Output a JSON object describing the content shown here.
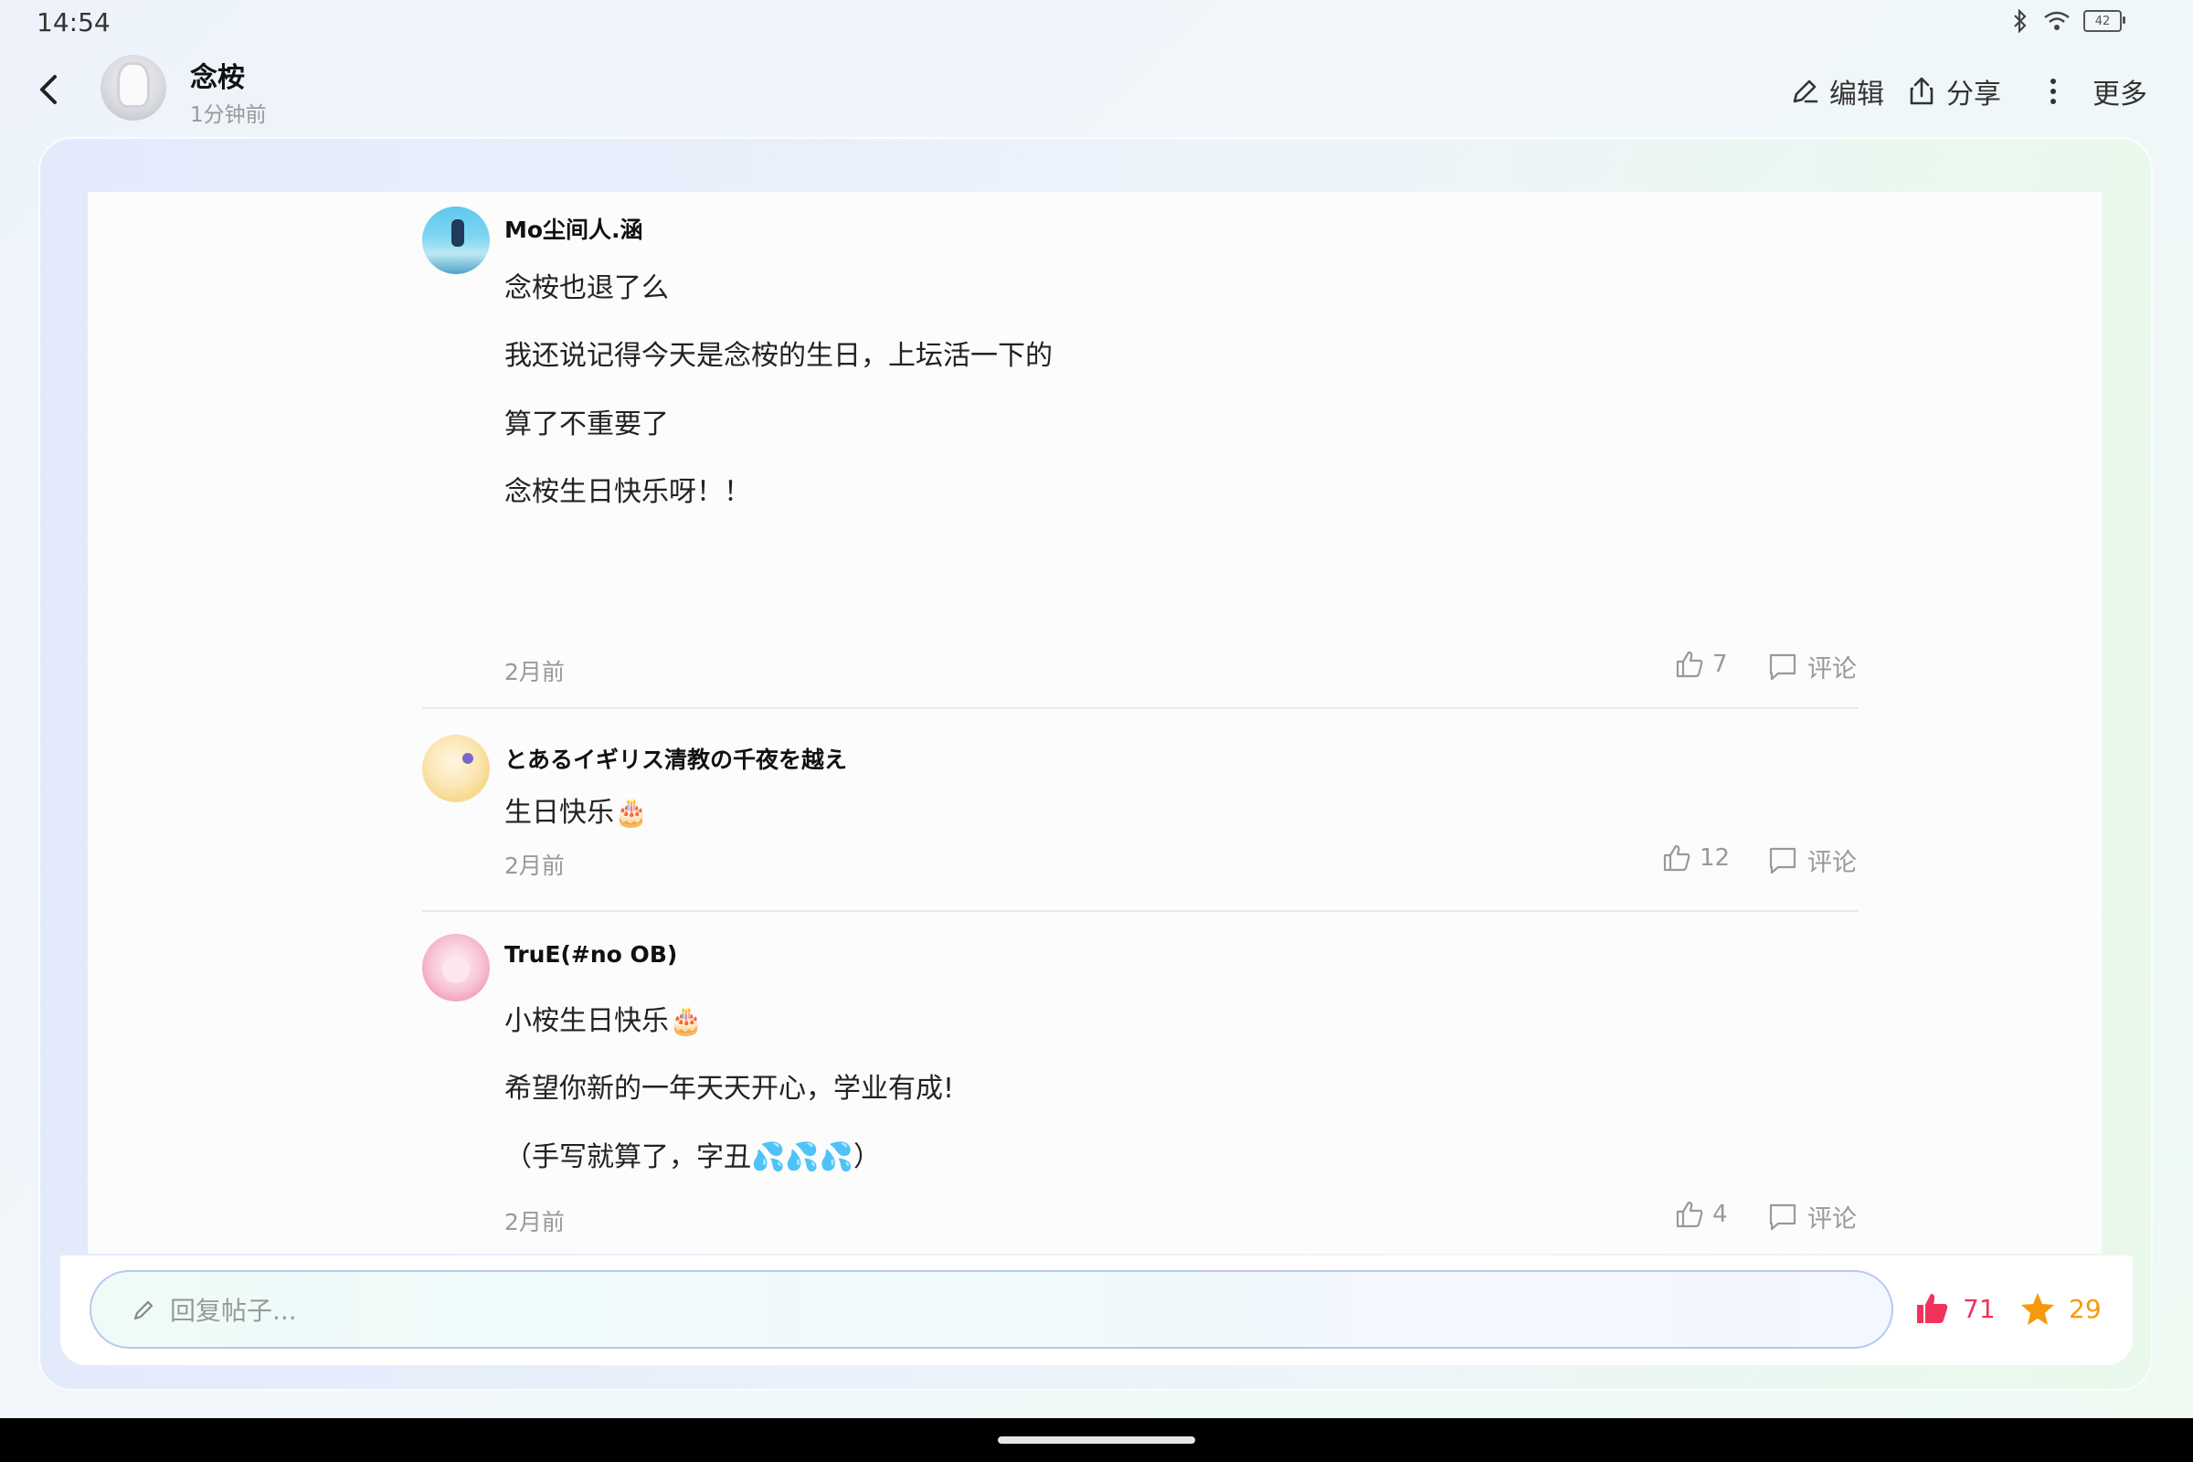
{
  "status": {
    "time": "14:54",
    "battery": "42"
  },
  "header": {
    "author": "念桉",
    "time": "1分钟前",
    "actions": {
      "edit": "编辑",
      "share": "分享",
      "more": "更多"
    }
  },
  "comments": [
    {
      "name": "Mo尘间人.涵",
      "lines": [
        "念桉也退了么",
        "我还说记得今天是念桉的生日，上坛活一下的",
        "算了不重要了",
        "念桉生日快乐呀！！"
      ],
      "time": "2月前",
      "likes": "7",
      "reply": "评论"
    },
    {
      "name": "とあるイギリス清教の千夜を越え",
      "lines": [
        "生日快乐🎂"
      ],
      "time": "2月前",
      "likes": "12",
      "reply": "评论"
    },
    {
      "name": "TruE(#no OB)",
      "lines": [
        "小桉生日快乐🎂",
        "希望你新的一年天天开心，学业有成!",
        "（手写就算了，字丑💦💦💦）"
      ],
      "time": "2月前",
      "likes": "4",
      "reply": "评论"
    }
  ],
  "reply_bar": {
    "placeholder": "回复帖子...",
    "like_count": "71",
    "star_count": "29"
  },
  "colors": {
    "like": "#f0335c",
    "star": "#f59a0c",
    "accent_border": "#b9c8f0"
  }
}
